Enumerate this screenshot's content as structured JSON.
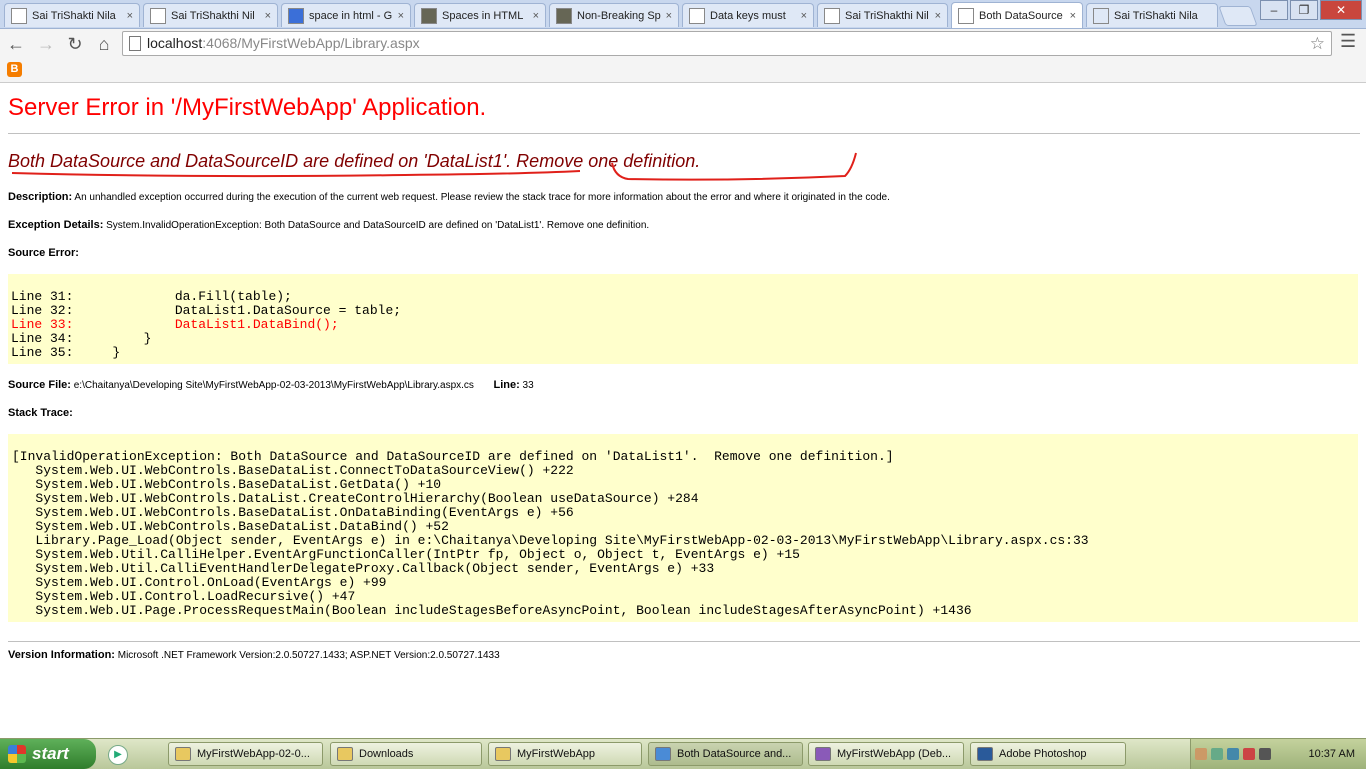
{
  "browser": {
    "tabs": [
      {
        "label": "Sai TriShakti Nila",
        "icon": "page-icon",
        "active": false
      },
      {
        "label": "Sai TriShakthi Nil",
        "icon": "page-icon",
        "active": false
      },
      {
        "label": "space in html - G",
        "icon": "google-icon",
        "active": false
      },
      {
        "label": "Spaces in HTML",
        "icon": "site-icon",
        "active": false
      },
      {
        "label": "Non-Breaking Sp",
        "icon": "site-icon",
        "active": false
      },
      {
        "label": "Data keys must",
        "icon": "page-icon",
        "active": false
      },
      {
        "label": "Sai TriShakthi Nil",
        "icon": "page-icon",
        "active": false
      },
      {
        "label": "Both DataSource",
        "icon": "page-icon",
        "active": true
      },
      {
        "label": "Sai TriShakti Nila",
        "icon": "loading-icon",
        "active": false
      }
    ],
    "url_host": "localhost",
    "url_path": ":4068/MyFirstWebApp/Library.aspx"
  },
  "page": {
    "title": "Server Error in '/MyFirstWebApp' Application.",
    "error_message": "Both DataSource and DataSourceID are defined on 'DataList1'.  Remove one definition.",
    "description_label": "Description:",
    "description_text": " An unhandled exception occurred during the execution of the current web request. Please review the stack trace for more information about the error and where it originated in the code.",
    "exception_label": "Exception Details:",
    "exception_text": " System.InvalidOperationException: Both DataSource and DataSourceID are defined on 'DataList1'.  Remove one definition.",
    "source_error_label": "Source Error:",
    "source_lines": [
      {
        "text": "Line 31:             da.Fill(table);",
        "highlight": false
      },
      {
        "text": "Line 32:             DataList1.DataSource = table;",
        "highlight": false
      },
      {
        "text": "Line 33:             DataList1.DataBind();",
        "highlight": true
      },
      {
        "text": "Line 34:         }",
        "highlight": false
      },
      {
        "text": "Line 35:     }",
        "highlight": false
      }
    ],
    "source_file_label": "Source File:",
    "source_file_value": " e:\\Chaitanya\\Developing Site\\MyFirstWebApp-02-03-2013\\MyFirstWebApp\\Library.aspx.cs",
    "line_label": "Line:",
    "line_value": " 33",
    "stack_trace_label": "Stack Trace:",
    "stack_lines": [
      "[InvalidOperationException: Both DataSource and DataSourceID are defined on 'DataList1'.  Remove one definition.]",
      "   System.Web.UI.WebControls.BaseDataList.ConnectToDataSourceView() +222",
      "   System.Web.UI.WebControls.BaseDataList.GetData() +10",
      "   System.Web.UI.WebControls.DataList.CreateControlHierarchy(Boolean useDataSource) +284",
      "   System.Web.UI.WebControls.BaseDataList.OnDataBinding(EventArgs e) +56",
      "   System.Web.UI.WebControls.BaseDataList.DataBind() +52",
      "   Library.Page_Load(Object sender, EventArgs e) in e:\\Chaitanya\\Developing Site\\MyFirstWebApp-02-03-2013\\MyFirstWebApp\\Library.aspx.cs:33",
      "   System.Web.Util.CalliHelper.EventArgFunctionCaller(IntPtr fp, Object o, Object t, EventArgs e) +15",
      "   System.Web.Util.CalliEventHandlerDelegateProxy.Callback(Object sender, EventArgs e) +33",
      "   System.Web.UI.Control.OnLoad(EventArgs e) +99",
      "   System.Web.UI.Control.LoadRecursive() +47",
      "   System.Web.UI.Page.ProcessRequestMain(Boolean includeStagesBeforeAsyncPoint, Boolean includeStagesAfterAsyncPoint) +1436"
    ],
    "version_label": "Version Information:",
    "version_text": " Microsoft .NET Framework Version:2.0.50727.1433; ASP.NET Version:2.0.50727.1433"
  },
  "taskbar": {
    "start_label": "start",
    "tasks": [
      {
        "label": "MyFirstWebApp-02-0...",
        "icon": "folder-icon",
        "active": false
      },
      {
        "label": "Downloads",
        "icon": "folder-icon",
        "active": false
      },
      {
        "label": "MyFirstWebApp",
        "icon": "folder-icon",
        "active": false
      },
      {
        "label": "Both DataSource and...",
        "icon": "chrome-icon",
        "active": true
      },
      {
        "label": "MyFirstWebApp (Deb...",
        "icon": "visual-studio-icon",
        "active": false
      },
      {
        "label": "Adobe Photoshop",
        "icon": "photoshop-icon",
        "active": false
      }
    ],
    "clock": "10:37 AM"
  },
  "colors": {
    "error_title": "#ff0000",
    "error_message": "#800000",
    "code_background": "#ffffcc",
    "annotation": "#e0201a"
  }
}
